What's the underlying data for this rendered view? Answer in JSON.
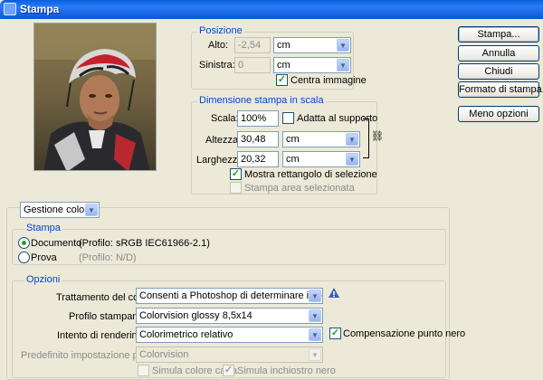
{
  "window": {
    "title": "Stampa"
  },
  "position": {
    "legend": "Posizione",
    "top_label": "Alto:",
    "top_value": "-2,54",
    "top_unit": "cm",
    "left_label": "Sinistra:",
    "left_value": "0",
    "left_unit": "cm",
    "center_label": "Centra immagine",
    "center_checked": true
  },
  "scale": {
    "legend": "Dimensione stampa in scala",
    "scale_label": "Scala:",
    "scale_value": "100%",
    "fit_label": "Adatta al supporto",
    "fit_checked": false,
    "height_label": "Altezza:",
    "height_value": "30,48",
    "height_unit": "cm",
    "width_label": "Larghezza:",
    "width_value": "20,32",
    "width_unit": "cm",
    "show_bbox_label": "Mostra rettangolo di selezione",
    "show_bbox_checked": true,
    "print_selected_label": "Stampa area selezionata",
    "print_selected_checked": false
  },
  "buttons": {
    "print": "Stampa...",
    "cancel": "Annulla",
    "close": "Chiudi",
    "page_setup": "Formato di stampa...",
    "fewer_options": "Meno opzioni"
  },
  "color_management": {
    "section_select": "Gestione colore",
    "print_legend": "Stampa",
    "document_label": "Documento",
    "document_profile": "(Profilo: sRGB IEC61966-2.1)",
    "proof_label": "Prova",
    "proof_profile": "(Profilo: N/D)",
    "selected_source": "document"
  },
  "options": {
    "legend": "Opzioni",
    "color_handling_label": "Trattamento del colore:",
    "color_handling_value": "Consenti a Photoshop di determinare i colori",
    "printer_profile_label": "Profilo stampante:",
    "printer_profile_value": "Colorvision glossy 8,5x14",
    "intent_label": "Intento di rendering:",
    "intent_value": "Colorimetrico relativo",
    "black_point_label": "Compensazione punto nero",
    "black_point_checked": true,
    "proof_setup_label": "Predefinito impostazione prova:",
    "proof_setup_value": "Colorvision",
    "simulate_paper_label": "Simula colore carta",
    "simulate_paper_checked": false,
    "simulate_ink_label": "Simula inchiostro nero",
    "simulate_ink_checked": true
  },
  "colors": {
    "titlebar": "#0a5fe0",
    "legend_text": "#0046d5",
    "dialog_bg": "#ece9d8",
    "check_green": "#21a121"
  }
}
